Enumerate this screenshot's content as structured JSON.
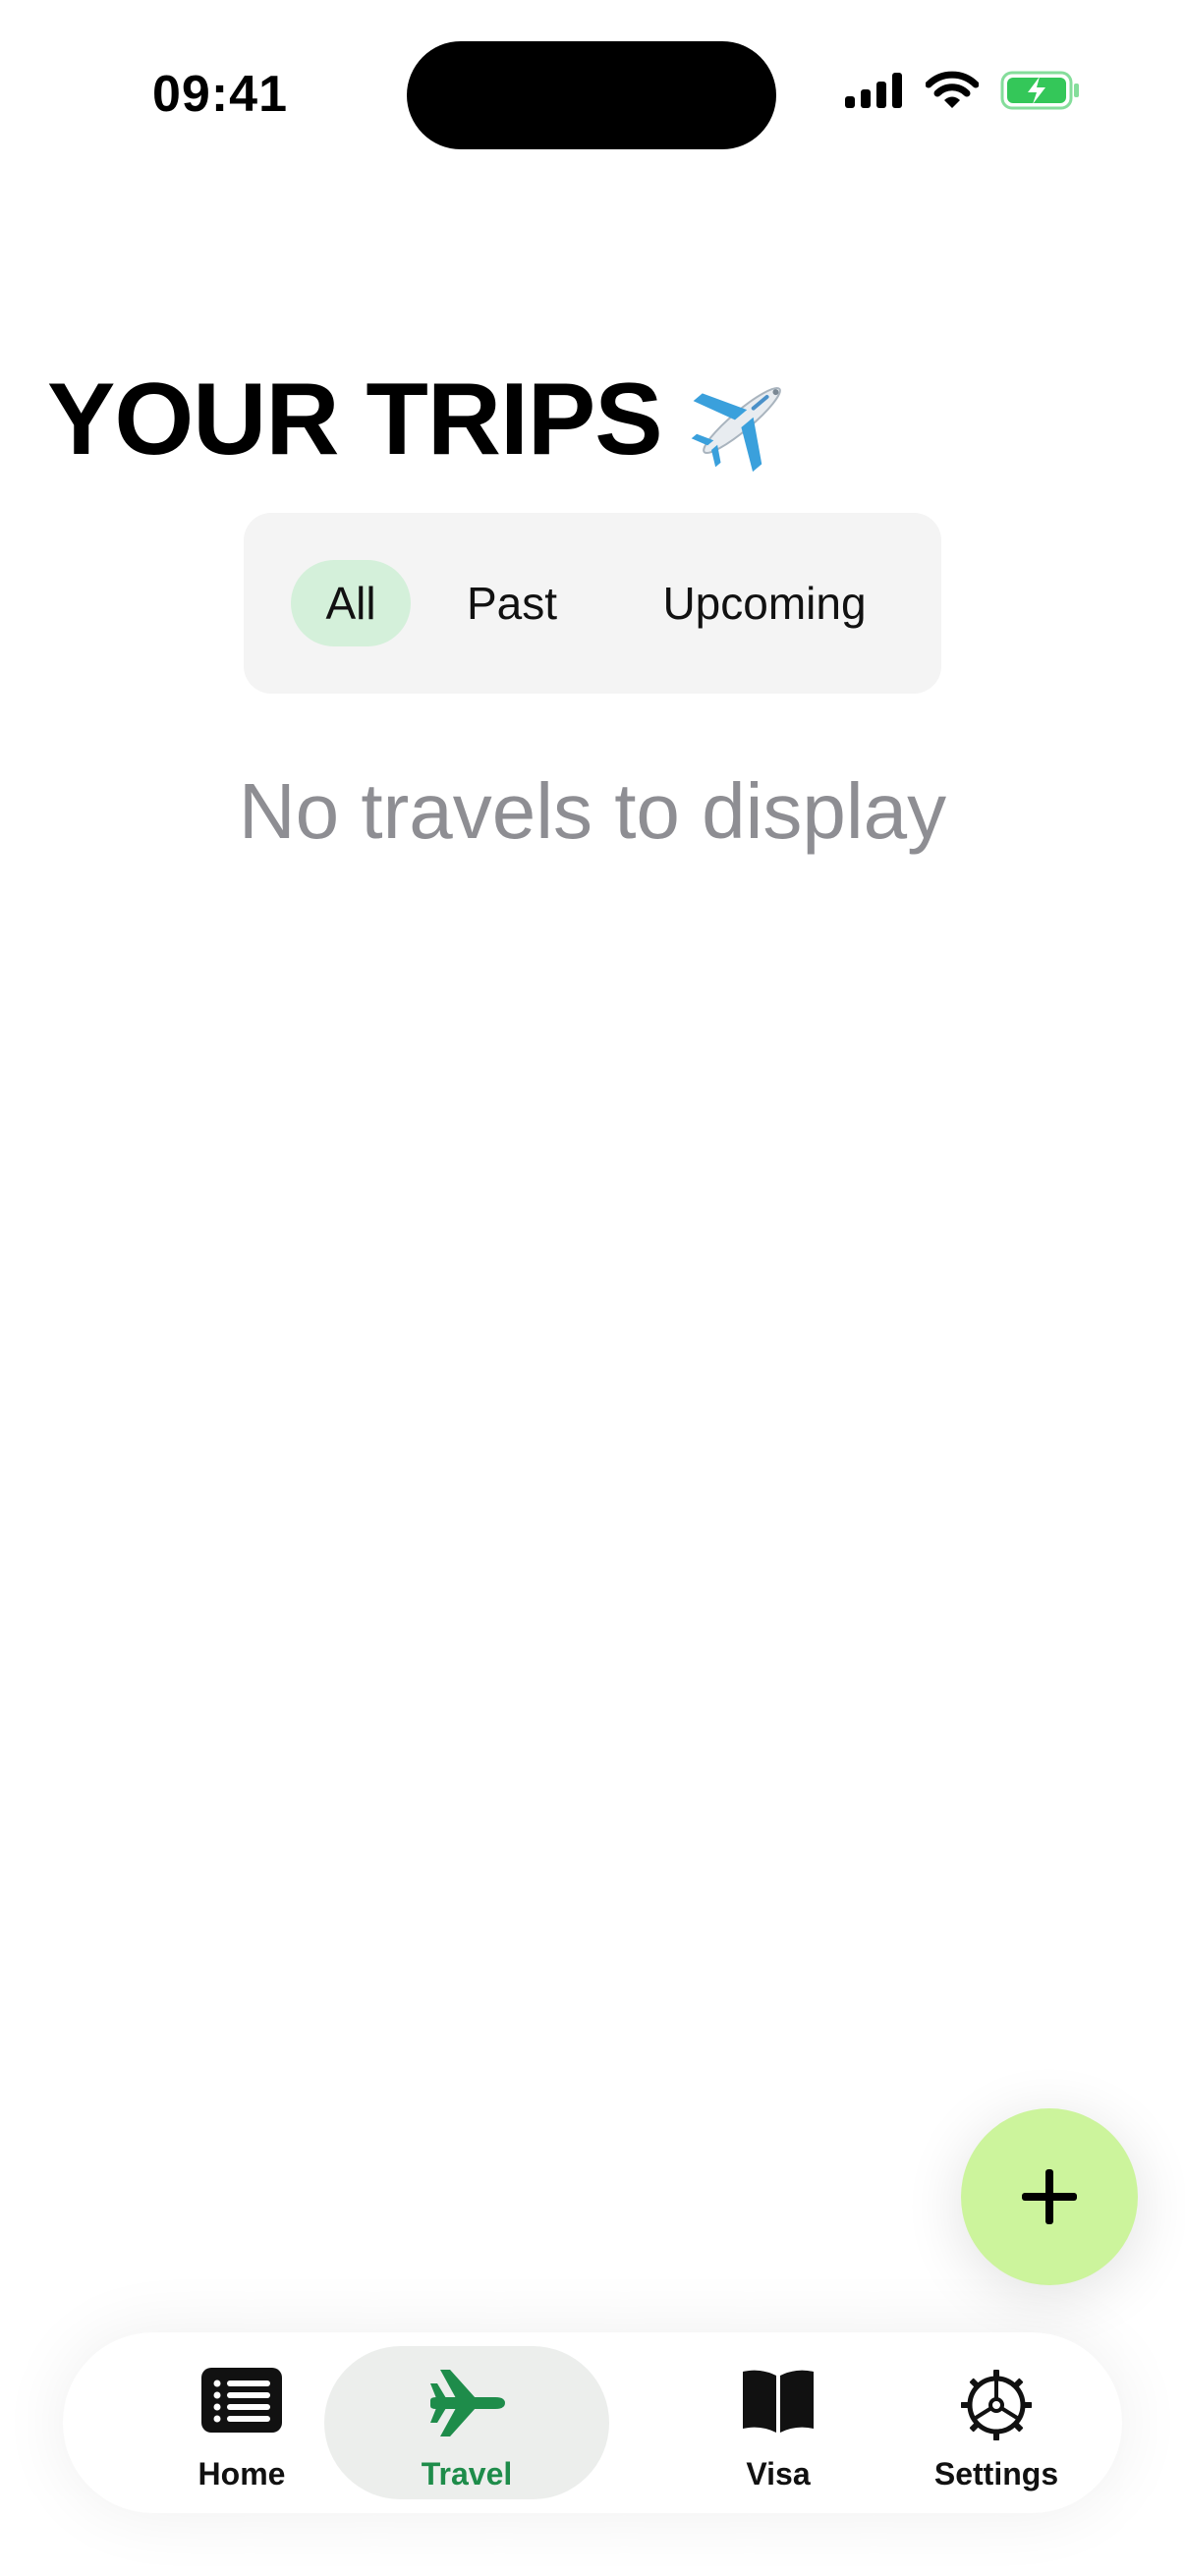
{
  "status_bar": {
    "time": "09:41"
  },
  "header": {
    "title": "YOUR TRIPS",
    "title_emoji": "✈️"
  },
  "filter": {
    "options": [
      "All",
      "Past",
      "Upcoming"
    ],
    "selected": "All"
  },
  "empty_state": {
    "message": "No travels to display"
  },
  "fab": {
    "icon": "plus-icon"
  },
  "tabbar": {
    "items": [
      {
        "label": "Home",
        "icon": "list-icon"
      },
      {
        "label": "Travel",
        "icon": "airplane-icon"
      },
      {
        "label": "Visa",
        "icon": "book-icon"
      },
      {
        "label": "Settings",
        "icon": "gear-icon"
      }
    ],
    "active": "Travel"
  },
  "colors": {
    "accent_green": "#1e8c4a",
    "selected_chip": "#d4f0da",
    "fab_background": "#ccf49c",
    "battery_green": "#34c759",
    "muted_text": "#8e8e93"
  }
}
